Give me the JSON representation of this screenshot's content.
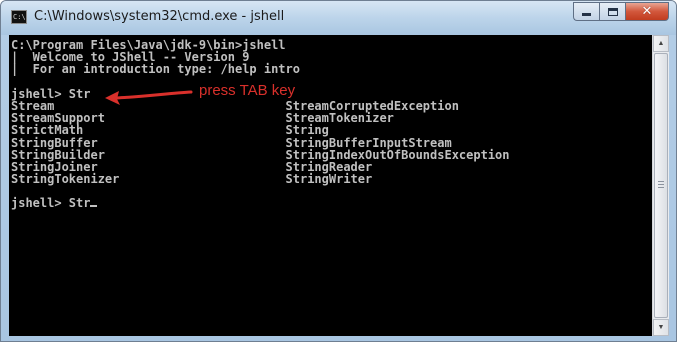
{
  "window": {
    "title": "C:\\Windows\\system32\\cmd.exe - jshell",
    "icon": "cmd-icon",
    "icon_text": "C:\\"
  },
  "console": {
    "lines": [
      "C:\\Program Files\\Java\\jdk-9\\bin>jshell",
      "|  Welcome to JShell -- Version 9",
      "|  For an introduction type: /help intro",
      "",
      "jshell> Str",
      "Stream                                StreamCorruptedException",
      "StreamSupport                         StreamTokenizer",
      "StrictMath                            String",
      "StringBuffer                          StringBufferInputStream",
      "StringBuilder                         StringIndexOutOfBoundsException",
      "StringJoiner                          StringReader",
      "StringTokenizer                       StringWriter",
      "",
      "jshell> Str"
    ],
    "text_color": "#c0c0c0",
    "background": "#000000"
  },
  "annotation": {
    "text": "press TAB key",
    "color": "#d9302b"
  }
}
